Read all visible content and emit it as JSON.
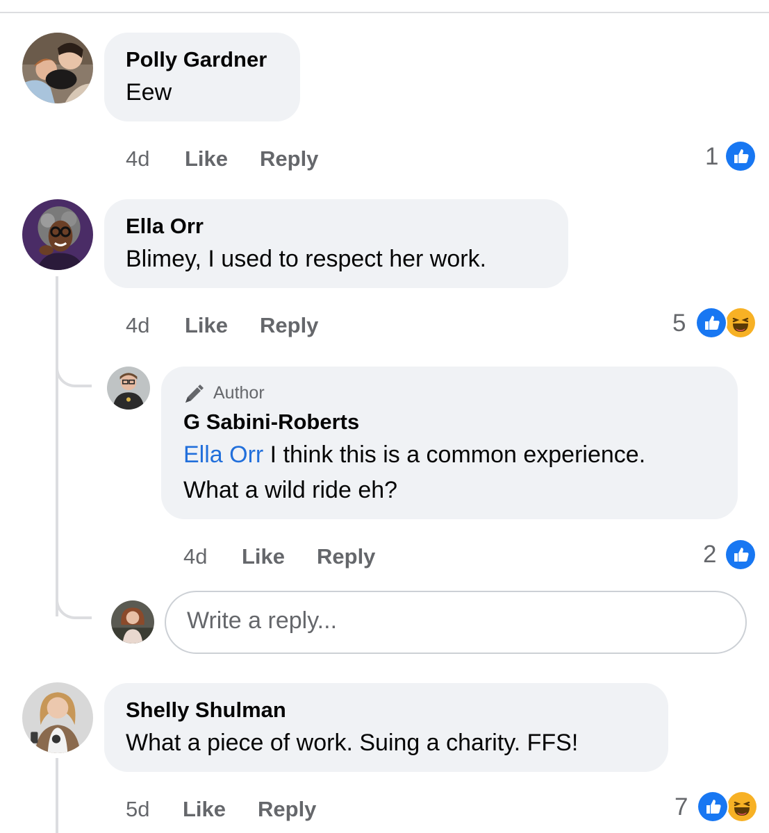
{
  "comments": [
    {
      "author": "Polly Gardner",
      "text": "Eew",
      "time": "4d",
      "like_label": "Like",
      "reply_label": "Reply",
      "reaction_count": "1",
      "reactions": [
        "like-icon"
      ]
    },
    {
      "author": "Ella Orr",
      "text": "Blimey, I used to respect her work.",
      "time": "4d",
      "like_label": "Like",
      "reply_label": "Reply",
      "reaction_count": "5",
      "reactions": [
        "like-icon",
        "haha-icon"
      ],
      "replies": [
        {
          "badge": "Author",
          "author": "G Sabini-Roberts",
          "mention": "Ella Orr",
          "text_line1": " I think this is a common experience.",
          "text_line2": "What a wild ride eh?",
          "time": "4d",
          "like_label": "Like",
          "reply_label": "Reply",
          "reaction_count": "2",
          "reactions": [
            "like-icon"
          ]
        }
      ],
      "reply_input": {
        "placeholder": "Write a reply..."
      }
    },
    {
      "author": "Shelly Shulman",
      "text": "What a piece of work. Suing a charity. FFS!",
      "time": "5d",
      "like_label": "Like",
      "reply_label": "Reply",
      "reaction_count": "7",
      "reactions": [
        "like-icon",
        "haha-icon"
      ]
    }
  ],
  "colors": {
    "bubble_bg": "#f0f2f5",
    "meta_text": "#65676b",
    "mention": "#216fdb",
    "like_blue": "#1877f2",
    "haha_yellow": "#f7b125"
  }
}
